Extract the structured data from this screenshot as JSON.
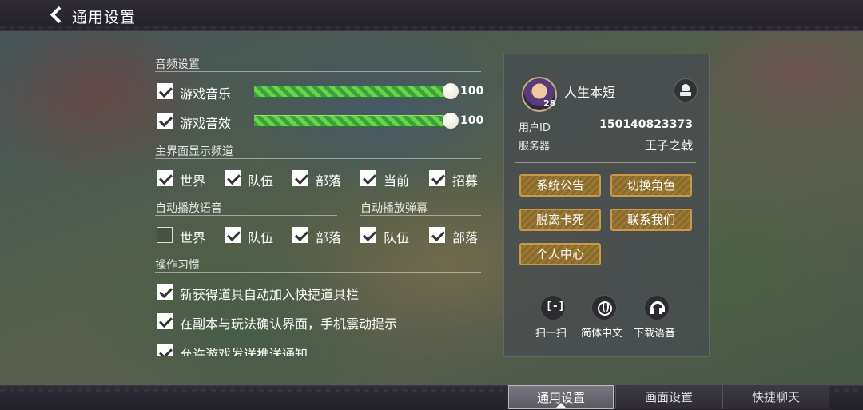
{
  "header": {
    "title": "通用设置"
  },
  "audio": {
    "section": "音频设置",
    "music": {
      "label": "游戏音乐",
      "checked": true,
      "value": "100",
      "level": 100
    },
    "sfx": {
      "label": "游戏音效",
      "checked": true,
      "value": "100",
      "level": 100
    }
  },
  "channels": {
    "section": "主界面显示频道",
    "items": [
      {
        "label": "世界",
        "checked": true
      },
      {
        "label": "队伍",
        "checked": true
      },
      {
        "label": "部落",
        "checked": true
      },
      {
        "label": "当前",
        "checked": true
      },
      {
        "label": "招募",
        "checked": true
      }
    ]
  },
  "autoplay_voice": {
    "section": "自动播放语音",
    "items": [
      {
        "label": "世界",
        "checked": false
      },
      {
        "label": "队伍",
        "checked": true
      },
      {
        "label": "部落",
        "checked": true
      }
    ]
  },
  "autoplay_danmaku": {
    "section": "自动播放弹幕",
    "items": [
      {
        "label": "队伍",
        "checked": true
      },
      {
        "label": "部落",
        "checked": true
      }
    ]
  },
  "habits": {
    "section": "操作习惯",
    "items": [
      {
        "label": "新获得道具自动加入快捷道具栏",
        "checked": true
      },
      {
        "label": "在副本与玩法确认界面，手机震动提示",
        "checked": true
      },
      {
        "label": "允许游戏发送推送通知",
        "checked": true
      }
    ]
  },
  "profile": {
    "name": "人生本短",
    "level": "28",
    "uid_label": "用户ID",
    "uid": "150140823373",
    "server_label": "服务器",
    "server": "王子之戟"
  },
  "actions": {
    "announce": "系统公告",
    "switch_role": "切换角色",
    "unstuck": "脱离卡死",
    "contact": "联系我们",
    "center": "个人中心"
  },
  "tools": {
    "scan": "扫一扫",
    "language": "简体中文",
    "voice": "下载语音"
  },
  "tabs": [
    {
      "label": "通用设置",
      "active": true
    },
    {
      "label": "画面设置",
      "active": false
    },
    {
      "label": "快捷聊天",
      "active": false
    }
  ]
}
